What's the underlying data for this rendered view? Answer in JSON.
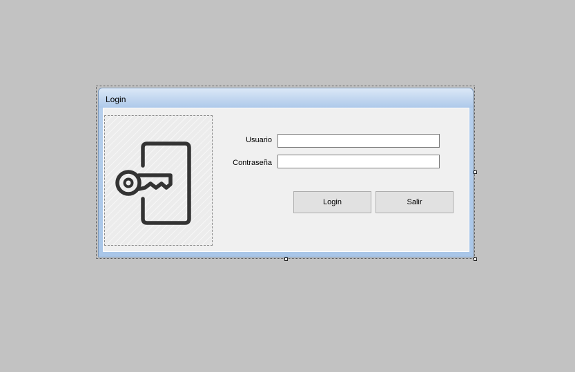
{
  "window": {
    "title": "Login"
  },
  "form": {
    "user_label": "Usuario",
    "user_value": "",
    "password_label": "Contraseña",
    "password_value": ""
  },
  "buttons": {
    "login_label": "Login",
    "exit_label": "Salir"
  },
  "picture": {
    "icon": "key-door-icon"
  },
  "colors": {
    "background": "#c2c2c2",
    "client": "#f0f0f0",
    "titlebar": "#c4d8f0",
    "button": "#e1e1e1",
    "icon_stroke": "#333333"
  }
}
